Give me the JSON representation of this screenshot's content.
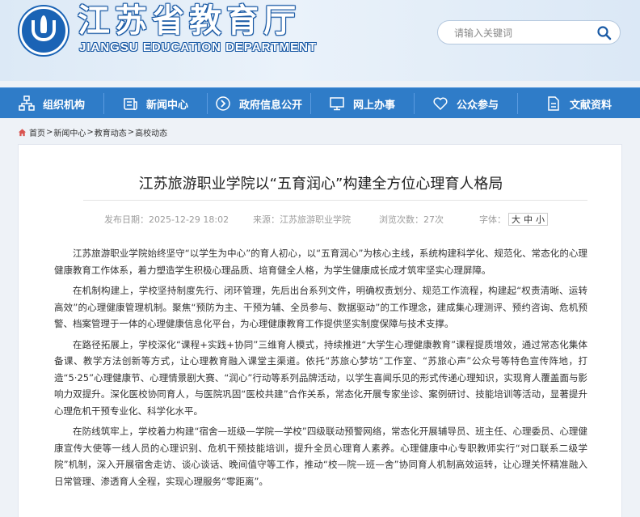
{
  "header": {
    "title": "江苏省教育厅",
    "subtitle": "JIANGSU EDUCATION DEPARTMENT",
    "search_placeholder": "请输入关键词"
  },
  "nav": {
    "items": [
      {
        "label": "组织机构",
        "icon": "org-chart-icon"
      },
      {
        "label": "新闻中心",
        "icon": "news-icon"
      },
      {
        "label": "政府信息公开",
        "icon": "info-disclosure-icon"
      },
      {
        "label": "网上办事",
        "icon": "online-service-icon"
      },
      {
        "label": "公众参与",
        "icon": "heart-icon"
      },
      {
        "label": "文献资料",
        "icon": "document-icon"
      }
    ]
  },
  "breadcrumb": {
    "items": [
      "首页",
      "新闻中心",
      "教育动态",
      "高校动态"
    ],
    "separator": ">"
  },
  "article": {
    "title": "江苏旅游职业学院以“五育润心”构建全方位心理育人格局",
    "date": "发布日期：2025-12-29 18:02",
    "source": "来源：江苏旅游职业学院",
    "views": "浏览次数：27次",
    "font_label": "字体：",
    "font_sizes": [
      "大",
      "中",
      "小"
    ],
    "paragraphs": [
      "江苏旅游职业学院始终坚守“以学生为中心”的育人初心，以“五育润心”为核心主线，系统构建科学化、规范化、常态化的心理健康教育工作体系，着力塑造学生积极心理品质、培育健全人格，为学生健康成长成才筑牢坚实心理屏障。",
      "在机制构建上，学校坚持制度先行、闭环管理，先后出台系列文件，明确权责划分、规范工作流程，构建起“权责清晰、运转高效”的心理健康管理机制。聚焦“预防为主、干预为辅、全员参与、数据驱动”的工作理念，建成集心理测评、预约咨询、危机预警、档案管理于一体的心理健康信息化平台，为心理健康教育工作提供坚实制度保障与技术支撑。",
      "在路径拓展上，学校深化“课程+实践+协同”三维育人模式，持续推进“大学生心理健康教育”课程提质增效，通过常态化集体备课、教学方法创新等方式，让心理教育融入课堂主渠道。依托“苏旅心梦坊”工作室、“苏旅心声”公众号等特色宣传阵地，打造“5·25”心理健康节、心理情景剧大赛、“润心”行动等系列品牌活动，以学生喜闻乐见的形式传递心理知识，实现育人覆盖面与影响力双提升。深化医校协同育人，与医院巩固“医校共建”合作关系，常态化开展专家坐诊、案例研讨、技能培训等活动，显著提升心理危机干预专业化、科学化水平。",
      "在防线筑牢上，学校着力构建“宿舍—班级—学院—学校”四级联动预警网络，常态化开展辅导员、班主任、心理委员、心理健康宣传大使等一线人员的心理识别、危机干预技能培训，提升全员心理育人素养。心理健康中心专职教师实行“对口联系二级学院”机制，深入开展宿舍走访、谈心谈话、晚间值守等工作，推动“校—院—班—舍”协同育人机制高效运转，让心理关怀精准融入日常管理、渗透育人全程，实现心理服务“零距离”。"
    ]
  },
  "colors": {
    "nav_bg": "#2f7cc8",
    "brand_blue": "#1a63b5",
    "page_bg": "#eef2f7"
  }
}
